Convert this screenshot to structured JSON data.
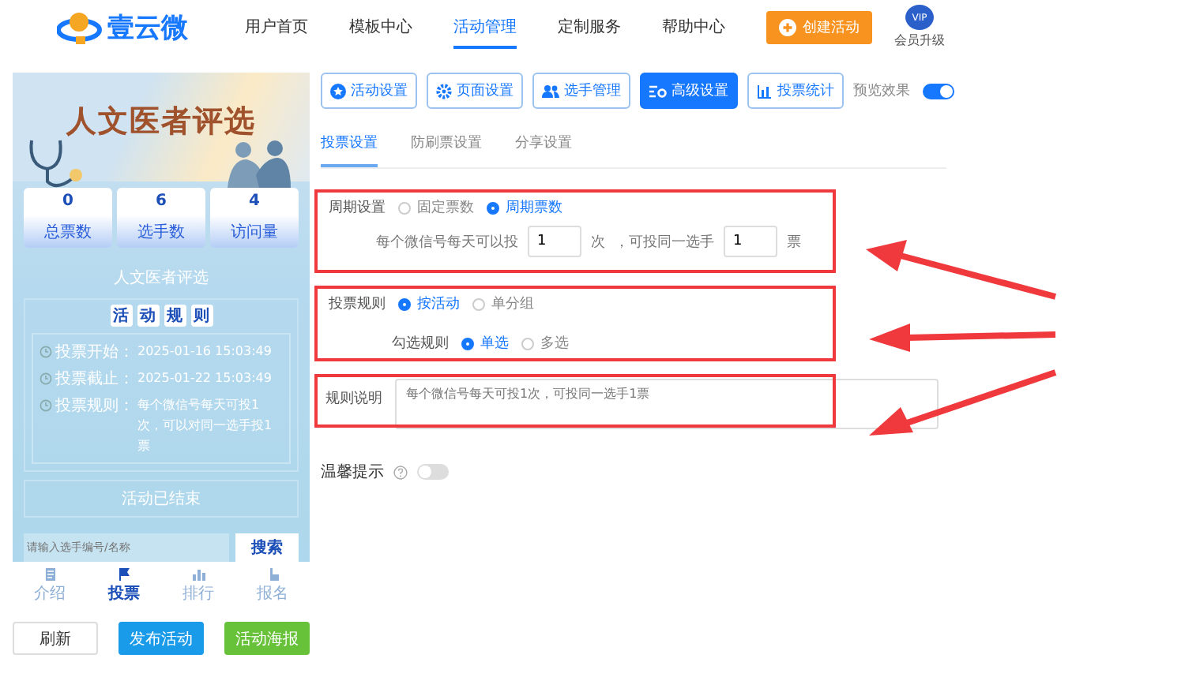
{
  "header": {
    "logo": "壹云微",
    "nav": [
      {
        "label": "用户首页",
        "selected": false
      },
      {
        "label": "模板中心",
        "selected": false
      },
      {
        "label": "活动管理",
        "selected": true
      },
      {
        "label": "定制服务",
        "selected": false
      },
      {
        "label": "帮助中心",
        "selected": false
      }
    ],
    "create_button": "创建活动",
    "vip_badge": "VIP",
    "vip_label": "会员升级"
  },
  "preview": {
    "banner_title": "人文医者评选",
    "stats": [
      {
        "value": "0",
        "label": "总票数"
      },
      {
        "value": "6",
        "label": "选手数"
      },
      {
        "value": "4",
        "label": "访问量"
      }
    ],
    "activity_name": "人文医者评选",
    "rules_heading": [
      "活",
      "动",
      "规",
      "则"
    ],
    "rules": [
      {
        "label": "投票开始：",
        "value": "2025-01-16 15:03:49"
      },
      {
        "label": "投票截止：",
        "value": "2025-01-22 15:03:49"
      },
      {
        "label": "投票规则：",
        "value": "每个微信号每天可投1次，可以对同一选手投1票"
      }
    ],
    "status": "活动已结束",
    "search_placeholder": "请输入选手编号/名称",
    "search_button": "搜索",
    "tabbar": [
      {
        "label": "介绍",
        "selected": false
      },
      {
        "label": "投票",
        "selected": true
      },
      {
        "label": "排行",
        "selected": false
      },
      {
        "label": "报名",
        "selected": false
      }
    ]
  },
  "actions": [
    {
      "label": "刷新",
      "kind": "plain"
    },
    {
      "label": "发布活动",
      "kind": "primary"
    },
    {
      "label": "活动海报",
      "kind": "success"
    }
  ],
  "toolbar": [
    {
      "label": "活动设置",
      "selected": false
    },
    {
      "label": "页面设置",
      "selected": false
    },
    {
      "label": "选手管理",
      "selected": false
    },
    {
      "label": "高级设置",
      "selected": true
    },
    {
      "label": "投票统计",
      "selected": false
    }
  ],
  "preview_toggle": {
    "label": "预览效果",
    "on": true
  },
  "subtabs": [
    {
      "label": "投票设置",
      "selected": true
    },
    {
      "label": "防刷票设置",
      "selected": false
    },
    {
      "label": "分享设置",
      "selected": false
    }
  ],
  "cycle": {
    "label": "周期设置",
    "options": [
      {
        "label": "固定票数",
        "selected": false
      },
      {
        "label": "周期票数",
        "selected": true
      }
    ],
    "sentence_start": "每个微信号每天可以投",
    "times_value": "1",
    "times_unit": "次",
    "sentence_mid": "，可投同一选手",
    "votes_value": "1",
    "votes_unit": "票"
  },
  "vote_rule": {
    "label": "投票规则",
    "options": [
      {
        "label": "按活动",
        "selected": true
      },
      {
        "label": "单分组",
        "selected": false
      }
    ],
    "check_label": "勾选规则",
    "check_options": [
      {
        "label": "单选",
        "selected": true
      },
      {
        "label": "多选",
        "selected": false
      }
    ]
  },
  "rule_text": {
    "label": "规则说明",
    "placeholder": "每个微信号每天可投1次，可投同一选手1票"
  },
  "tip": {
    "label": "温馨提示",
    "on": false
  }
}
